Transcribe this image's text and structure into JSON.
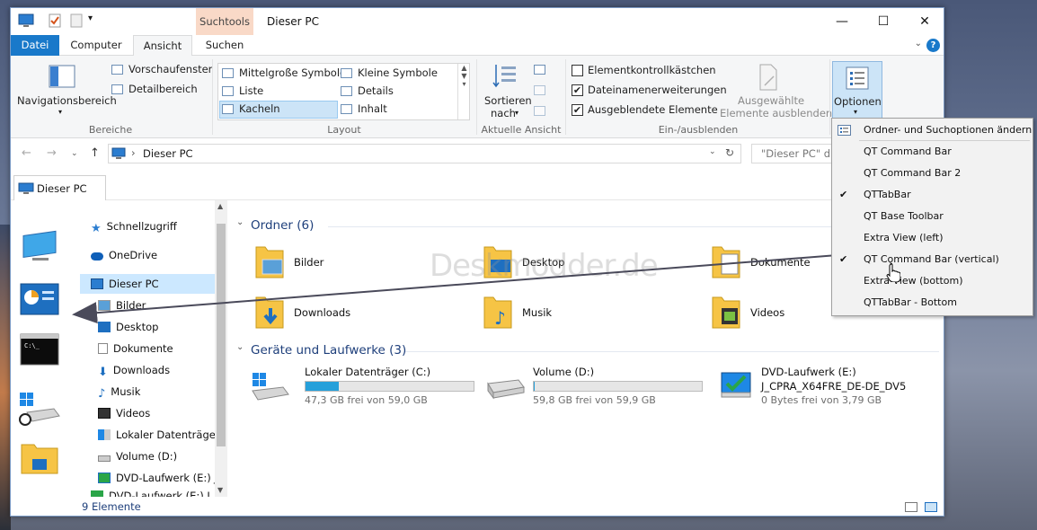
{
  "title_bar": {
    "context_tab": "Suchtools",
    "window_title": "Dieser PC",
    "minimize": "—",
    "maximize": "☐",
    "close": "✕"
  },
  "ribbon_tabs": [
    {
      "label": "Datei"
    },
    {
      "label": "Computer"
    },
    {
      "label": "Ansicht"
    },
    {
      "label": "Suchen"
    }
  ],
  "ribbon": {
    "bereiche": {
      "navigationsbereich": "Navigationsbereich",
      "vorschaufenster": "Vorschaufenster",
      "detailbereich": "Detailbereich",
      "group_label": "Bereiche"
    },
    "layout": {
      "items": [
        "Mittelgroße Symbole",
        "Kleine Symbole",
        "Liste",
        "Details",
        "Kacheln",
        "Inhalt"
      ],
      "selected": "Kacheln",
      "group_label": "Layout"
    },
    "aktuelle_ansicht": {
      "sortieren": "Sortieren",
      "nach": "nach",
      "group_label": "Aktuelle Ansicht"
    },
    "ein_ausblenden": {
      "checkboxes": [
        {
          "label": "Elementkontrollkästchen",
          "checked": false
        },
        {
          "label": "Dateinamenerweiterungen",
          "checked": true
        },
        {
          "label": "Ausgeblendete Elemente",
          "checked": true
        }
      ],
      "ausgewaehlte_1": "Ausgewählte",
      "ausgewaehlte_2": "Elemente ausblenden",
      "group_label": "Ein-/ausblenden"
    },
    "optionen": {
      "label": "Optionen"
    }
  },
  "address": {
    "path": "Dieser PC",
    "search_placeholder": "\"Dieser PC\" du"
  },
  "qttab": {
    "label": "Dieser PC"
  },
  "nav_pane": {
    "items": [
      {
        "label": "Schnellzugriff"
      },
      {
        "label": "OneDrive"
      },
      {
        "label": "Dieser PC"
      },
      {
        "label": "Bilder"
      },
      {
        "label": "Desktop"
      },
      {
        "label": "Dokumente"
      },
      {
        "label": "Downloads"
      },
      {
        "label": "Musik"
      },
      {
        "label": "Videos"
      },
      {
        "label": "Lokaler Datenträger"
      },
      {
        "label": "Volume (D:)"
      },
      {
        "label": "DVD-Laufwerk (E:) J_"
      },
      {
        "label": "DVD-Laufwerk (E:) J_C"
      }
    ]
  },
  "content": {
    "folders_header": "Ordner (6)",
    "folders": [
      {
        "label": "Bilder"
      },
      {
        "label": "Desktop"
      },
      {
        "label": "Dokumente"
      },
      {
        "label": "Downloads"
      },
      {
        "label": "Musik"
      },
      {
        "label": "Videos"
      }
    ],
    "drives_header": "Geräte und Laufwerke (3)",
    "drives": [
      {
        "name": "Lokaler Datenträger (C:)",
        "free": "47,3 GB frei von 59,0 GB",
        "used_fraction": 0.2
      },
      {
        "name": "Volume (D:)",
        "free": "59,8 GB frei von 59,9 GB",
        "used_fraction": 0.002
      },
      {
        "name": "DVD-Laufwerk (E:)",
        "name2": "J_CPRA_X64FRE_DE-DE_DV5",
        "free": "0 Bytes frei von 3,79 GB",
        "used_fraction": 1.0
      }
    ]
  },
  "status": {
    "count": "9 Elemente"
  },
  "options_menu": {
    "items": [
      {
        "label": "Ordner- und Suchoptionen ändern",
        "checked": false
      },
      {
        "label": "QT Command Bar",
        "checked": false
      },
      {
        "label": "QT Command Bar 2",
        "checked": false
      },
      {
        "label": "QTTabBar",
        "checked": true
      },
      {
        "label": "QT Base Toolbar",
        "checked": false
      },
      {
        "label": "Extra View (left)",
        "checked": false
      },
      {
        "label": "QT Command Bar (vertical)",
        "checked": true
      },
      {
        "label": "Extra View (bottom)",
        "checked": false
      },
      {
        "label": "QTTabBar - Bottom",
        "checked": false
      }
    ],
    "check_mark": "✔"
  },
  "watermark": "Deskmodder.de",
  "colors": {
    "accent": "#1979ca",
    "selection": "#cce8ff",
    "drive_fill": "#26a0da",
    "drive_full": "#da2626"
  }
}
